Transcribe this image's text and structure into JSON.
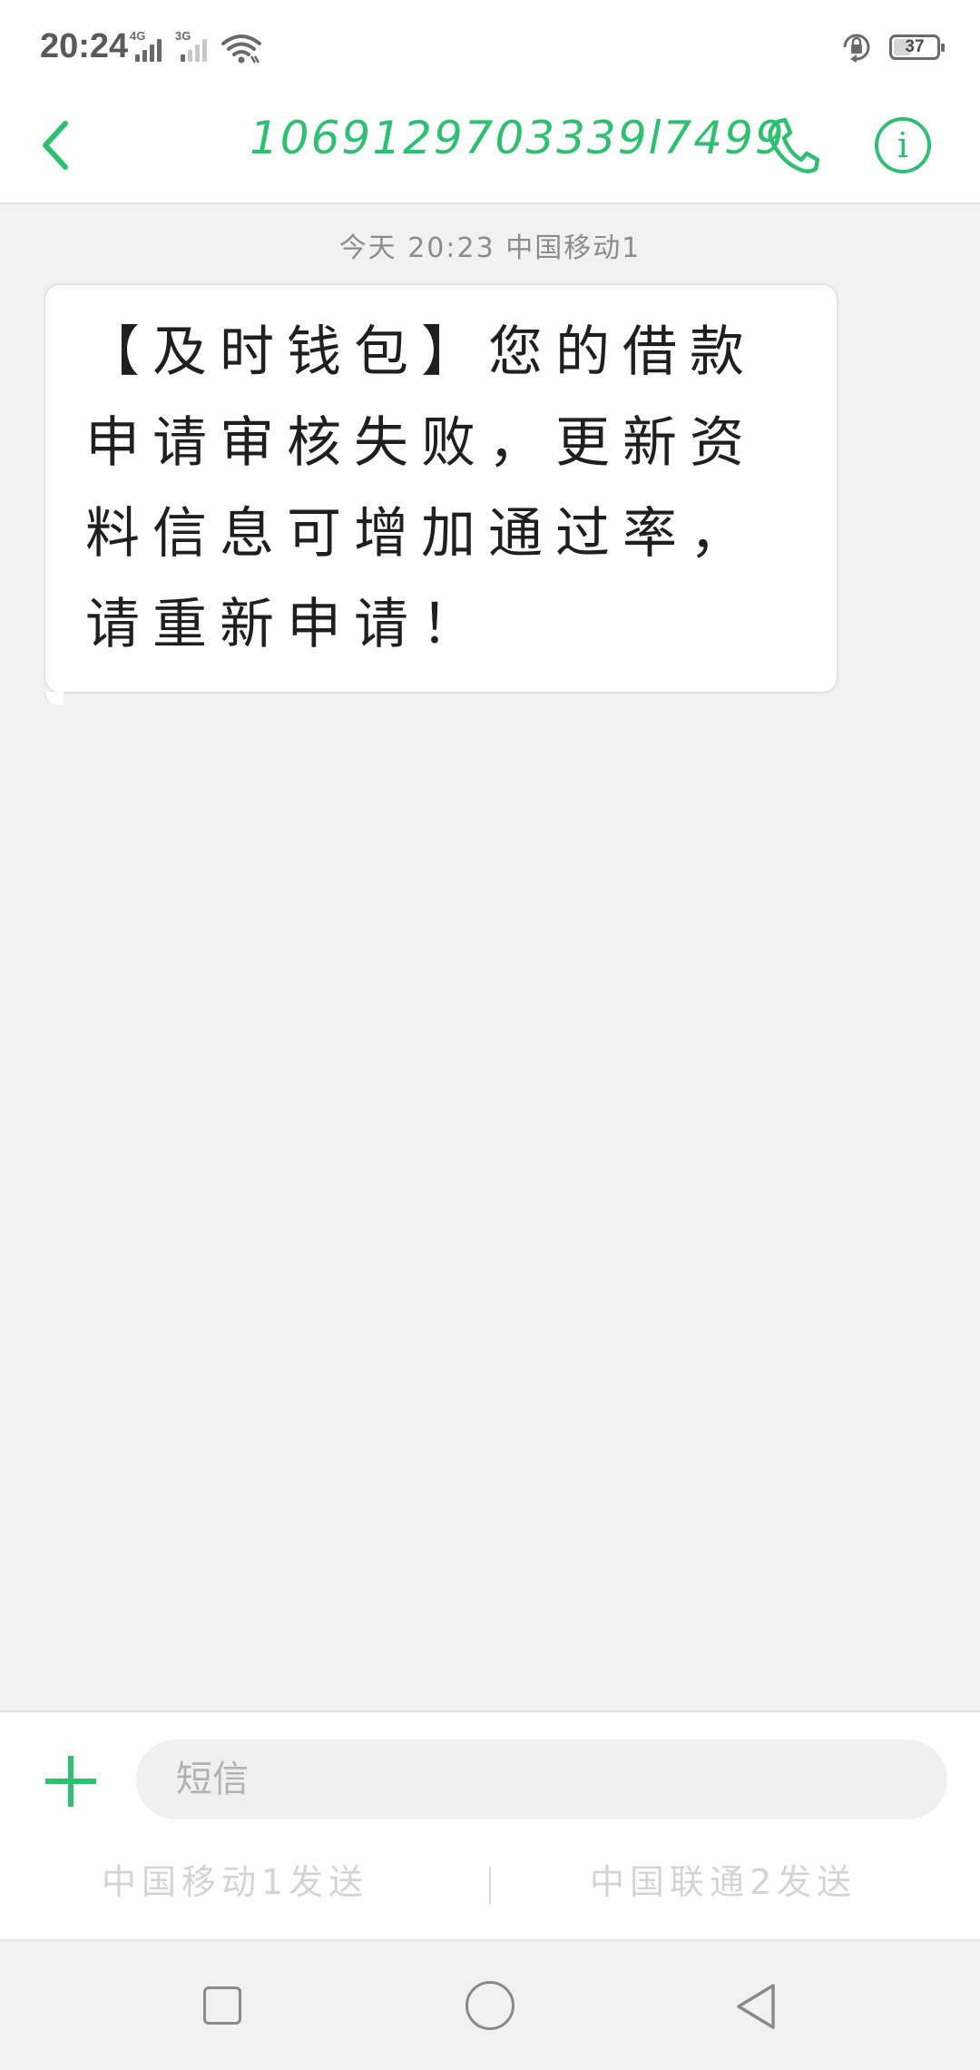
{
  "status_bar": {
    "time": "20:24",
    "sim1_network": "4G",
    "sim2_network": "3G",
    "battery_level": "37",
    "icons": [
      "signal-sim1-icon",
      "signal-sim2-icon",
      "wifi-icon",
      "rotation-lock-icon",
      "battery-icon"
    ]
  },
  "header": {
    "title": "1069129703339l7499",
    "back_icon": "chevron-left-icon",
    "call_icon": "phone-icon",
    "info_label": "i"
  },
  "conversation": {
    "timestamp": "今天 20:23 中国移动1",
    "messages": [
      {
        "text": "【及时钱包】您的借款申请审核失败，更新资料信息可增加通过率，请重新申请！"
      }
    ]
  },
  "composer": {
    "placeholder": "短信",
    "send_sim1": "中国移动1发送",
    "send_sim2": "中国联通2发送"
  },
  "colors": {
    "accent": "#2fbf71",
    "background": "#f1f1f1"
  }
}
